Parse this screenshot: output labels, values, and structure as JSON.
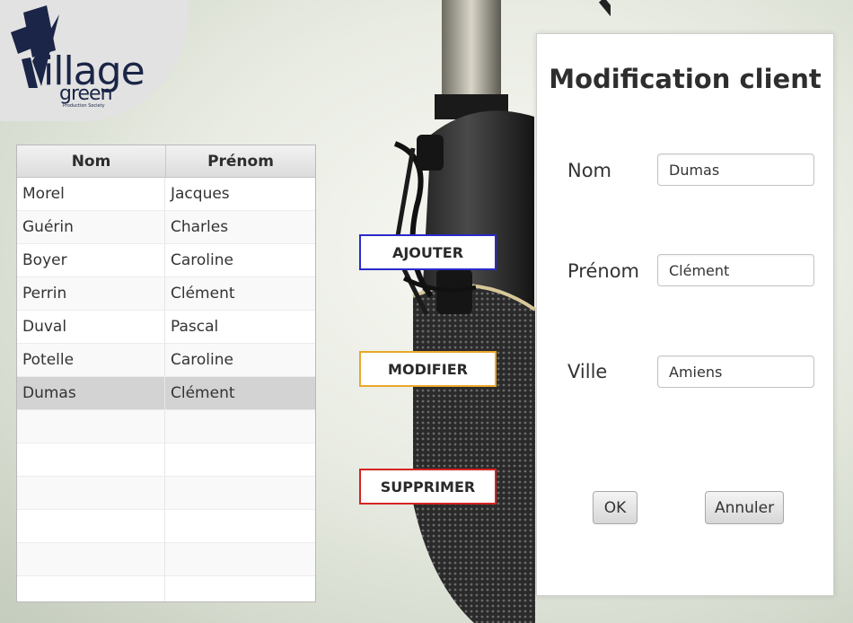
{
  "logo": {
    "main": "illage",
    "sub": "green",
    "tagline": "Production Society",
    "color": "#1a2547"
  },
  "table": {
    "columns": [
      "Nom",
      "Prénom"
    ],
    "rows": [
      {
        "nom": "Morel",
        "prenom": "Jacques"
      },
      {
        "nom": "Guérin",
        "prenom": "Charles"
      },
      {
        "nom": "Boyer",
        "prenom": "Caroline"
      },
      {
        "nom": "Perrin",
        "prenom": "Clément"
      },
      {
        "nom": "Duval",
        "prenom": "Pascal"
      },
      {
        "nom": "Potelle",
        "prenom": "Caroline"
      },
      {
        "nom": "Dumas",
        "prenom": "Clément"
      }
    ],
    "selected_index": 6,
    "empty_row_count": 6
  },
  "actions": {
    "add_label": "AJOUTER",
    "modify_label": "MODIFIER",
    "delete_label": "SUPPRIMER",
    "add_color": "#2a2acb",
    "modify_color": "#e9a82a",
    "delete_color": "#d42424"
  },
  "dialog": {
    "title": "Modification client",
    "nom_label": "Nom",
    "nom_value": "Dumas",
    "prenom_label": "Prénom",
    "prenom_value": "Clément",
    "ville_label": "Ville",
    "ville_value": "Amiens",
    "ok_label": "OK",
    "cancel_label": "Annuler"
  }
}
